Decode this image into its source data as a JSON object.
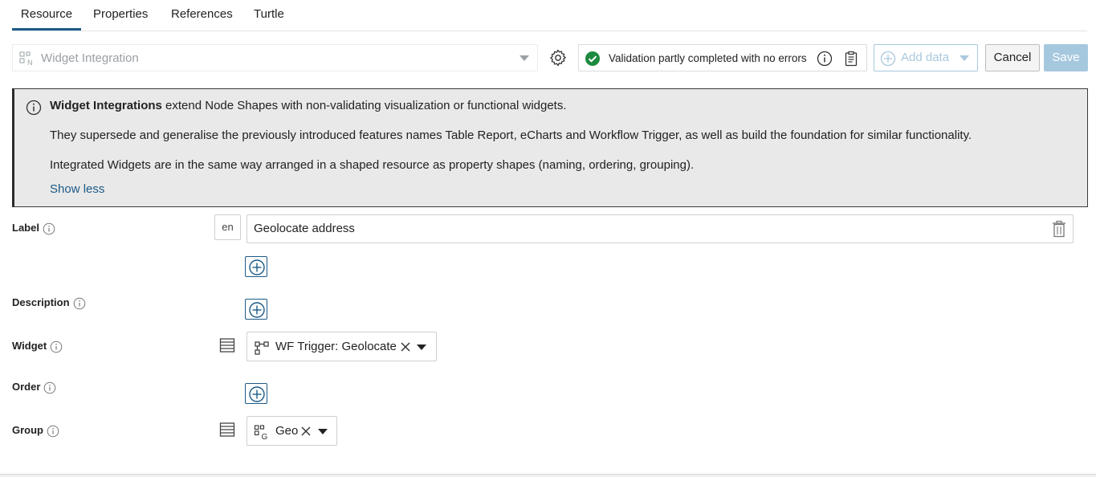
{
  "tabs": [
    {
      "label": "Resource",
      "active": true
    },
    {
      "label": "Properties",
      "active": false
    },
    {
      "label": "References",
      "active": false
    },
    {
      "label": "Turtle",
      "active": false
    }
  ],
  "toolbar": {
    "shape_select": {
      "value": "Widget Integration",
      "icon": "node-shape-icon"
    },
    "settings_icon": "gear-icon",
    "validation": {
      "text": "Validation partly completed with no errors",
      "status_color": "#1d8a3f"
    },
    "add_data_label": "Add data",
    "cancel_label": "Cancel",
    "save_label": "Save"
  },
  "info_panel": {
    "p1_bold": "Widget Integrations",
    "p1_rest": " extend Node Shapes with non-validating visualization or functional widgets.",
    "p2": "They supersede and generalise the previously introduced features names Table Report, eCharts and Workflow Trigger, as well as build the foundation for similar functionality.",
    "p3": "Integrated Widgets are in the same way arranged in a shaped resource as property shapes (naming, ordering, grouping).",
    "toggle_label": "Show less"
  },
  "form": {
    "label": {
      "title": "Label",
      "lang": "en",
      "value": "Geolocate address"
    },
    "description": {
      "title": "Description"
    },
    "widget": {
      "title": "Widget",
      "value": "WF Trigger: Geolocate"
    },
    "order": {
      "title": "Order"
    },
    "group": {
      "title": "Group",
      "value": "Geo"
    }
  },
  "colors": {
    "accent": "#1b5a86",
    "save_disabled": "#a6c8de",
    "panel_bg": "#e9e9e9"
  }
}
